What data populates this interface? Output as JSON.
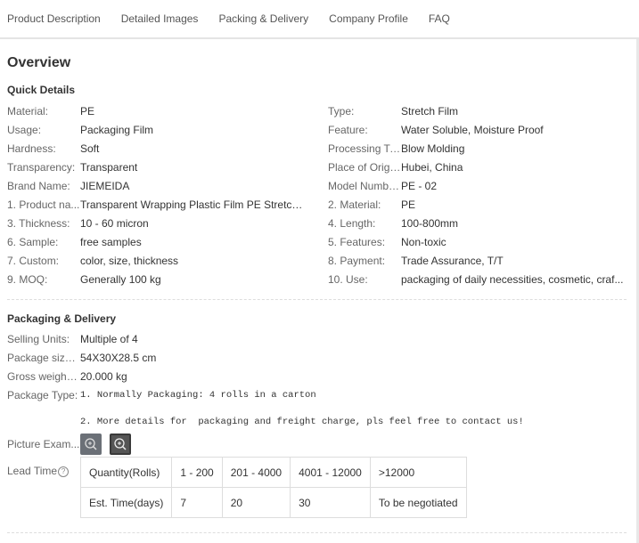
{
  "tabs": [
    "Product Description",
    "Detailed Images",
    "Packing & Delivery",
    "Company Profile",
    "FAQ"
  ],
  "overview_title": "Overview",
  "quick_details": {
    "title": "Quick Details",
    "left": [
      {
        "label": "Material:",
        "value": "PE"
      },
      {
        "label": "Usage:",
        "value": "Packaging Film"
      },
      {
        "label": "Hardness:",
        "value": "Soft"
      },
      {
        "label": "Transparency:",
        "value": "Transparent"
      },
      {
        "label": "Brand Name:",
        "value": "JIEMEIDA"
      },
      {
        "label": "1. Product na...",
        "value": "Transparent Wrapping Plastic Film PE Stretch ..."
      },
      {
        "label": "3. Thickness:",
        "value": "10 - 60 micron"
      },
      {
        "label": "6. Sample:",
        "value": "free samples"
      },
      {
        "label": "7. Custom:",
        "value": "color, size, thickness"
      },
      {
        "label": "9. MOQ:",
        "value": "Generally 100 kg"
      }
    ],
    "right": [
      {
        "label": "Type:",
        "value": "Stretch Film"
      },
      {
        "label": "Feature:",
        "value": "Water Soluble, Moisture Proof"
      },
      {
        "label": "Processing Ty...",
        "value": "Blow Molding"
      },
      {
        "label": "Place of Origin:",
        "value": "Hubei, China"
      },
      {
        "label": "Model Number:",
        "value": "PE - 02"
      },
      {
        "label": "2. Material:",
        "value": "PE"
      },
      {
        "label": "4. Length:",
        "value": "100-800mm"
      },
      {
        "label": "5. Features:",
        "value": "Non-toxic"
      },
      {
        "label": "8. Payment:",
        "value": "Trade Assurance, T/T"
      },
      {
        "label": "10. Use:",
        "value": "packaging of daily necessities, cosmetic, craf..."
      }
    ]
  },
  "packaging": {
    "title": "Packaging & Delivery",
    "selling_units_label": "Selling Units:",
    "selling_units": "Multiple of 4",
    "package_size_label": "Package size ...",
    "package_size": "54X30X28.5 cm",
    "gross_weight_label": "Gross weight ...",
    "gross_weight": "20.000 kg",
    "package_type_label": "Package Type:",
    "package_type_line1": "1. Normally Packaging: 4 rolls in a carton",
    "package_type_line2": "2. More details for  packaging and freight charge, pls feel free to contact us!",
    "picture_label": "Picture Exam...",
    "lead_time_label": "Lead Time",
    "lead_time_help": "?",
    "lead_table": {
      "row1": [
        "Quantity(Rolls)",
        "1 - 200",
        "201 - 4000",
        "4001 - 12000",
        ">12000"
      ],
      "row2": [
        "Est. Time(days)",
        "7",
        "20",
        "30",
        "To be negotiated"
      ]
    }
  }
}
